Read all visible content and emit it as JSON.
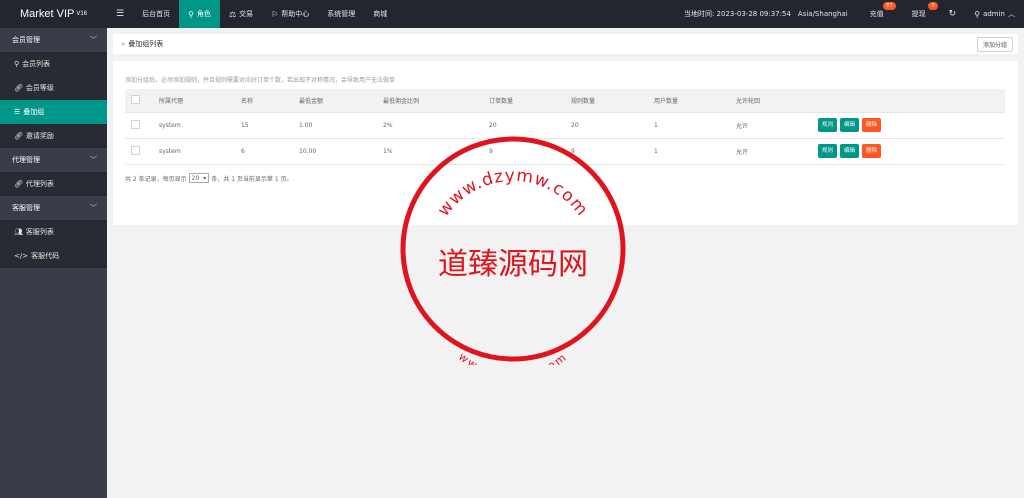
{
  "app": {
    "logo": "Market VIP",
    "version": "V16"
  },
  "header": {
    "menu_icon": "menu-icon",
    "nav": [
      {
        "label": "后台首页",
        "icon": ""
      },
      {
        "label": "角色",
        "icon": "user-icon",
        "active": true
      },
      {
        "label": "交易",
        "icon": "scale-icon"
      },
      {
        "label": "帮助中心",
        "icon": "flag-icon"
      },
      {
        "label": "系统管理",
        "icon": ""
      },
      {
        "label": "商城",
        "icon": ""
      }
    ],
    "time_label": "当地时间: 2023-03-28 09:37:54",
    "timezone": "Asia/Shanghai",
    "recharge_label": "充值",
    "recharge_badge": "87",
    "withdraw_label": "提现",
    "withdraw_badge": "0",
    "user": "admin"
  },
  "sidebar": {
    "groups": [
      {
        "label": "会员管理",
        "items": [
          {
            "label": "会员列表",
            "icon": "user-icon"
          },
          {
            "label": "会员等级",
            "icon": "link-icon"
          },
          {
            "label": "叠加组",
            "icon": "list-icon",
            "active": true
          },
          {
            "label": "邀请奖励",
            "icon": "link-icon"
          }
        ]
      },
      {
        "label": "代理管理",
        "items": [
          {
            "label": "代理列表",
            "icon": "link-icon"
          }
        ]
      },
      {
        "label": "客服管理",
        "items": [
          {
            "label": "客服列表",
            "icon": "users-icon"
          },
          {
            "label": "客服代码",
            "icon": "code-icon"
          }
        ]
      }
    ]
  },
  "page": {
    "title": "叠加组列表",
    "add_button": "添加分组",
    "tip": "添加分组后，必须添加规则，并且规则需要对应好订单个数，若出现不对称情况，会导致用户无法做单",
    "table": {
      "headers": [
        "所属代理",
        "名称",
        "最低金额",
        "最低佣金比例",
        "订单数量",
        "规则数量",
        "用户数量",
        "允许轮回"
      ],
      "rows": [
        [
          "system",
          "15",
          "1.00",
          "2%",
          "20",
          "20",
          "1",
          "允许"
        ],
        [
          "system",
          "6",
          "10.00",
          "1%",
          "9",
          "9",
          "1",
          "允许"
        ]
      ],
      "actions": [
        "规则",
        "编辑",
        "删除"
      ]
    },
    "pager": {
      "prefix": "共 2 条记录，每页显示",
      "size": "20",
      "suffix": "条，共 1 页当前显示第 1 页。"
    }
  },
  "watermark": {
    "center": "道臻源码网",
    "ring_outer": "www.dzymw.com",
    "ring_inner": "www.dzymw.com",
    "color": "#e0141e"
  },
  "colors": {
    "accent": "#009688",
    "danger": "#ff5722",
    "topbar": "#23262e",
    "sidebar": "#393d49"
  }
}
